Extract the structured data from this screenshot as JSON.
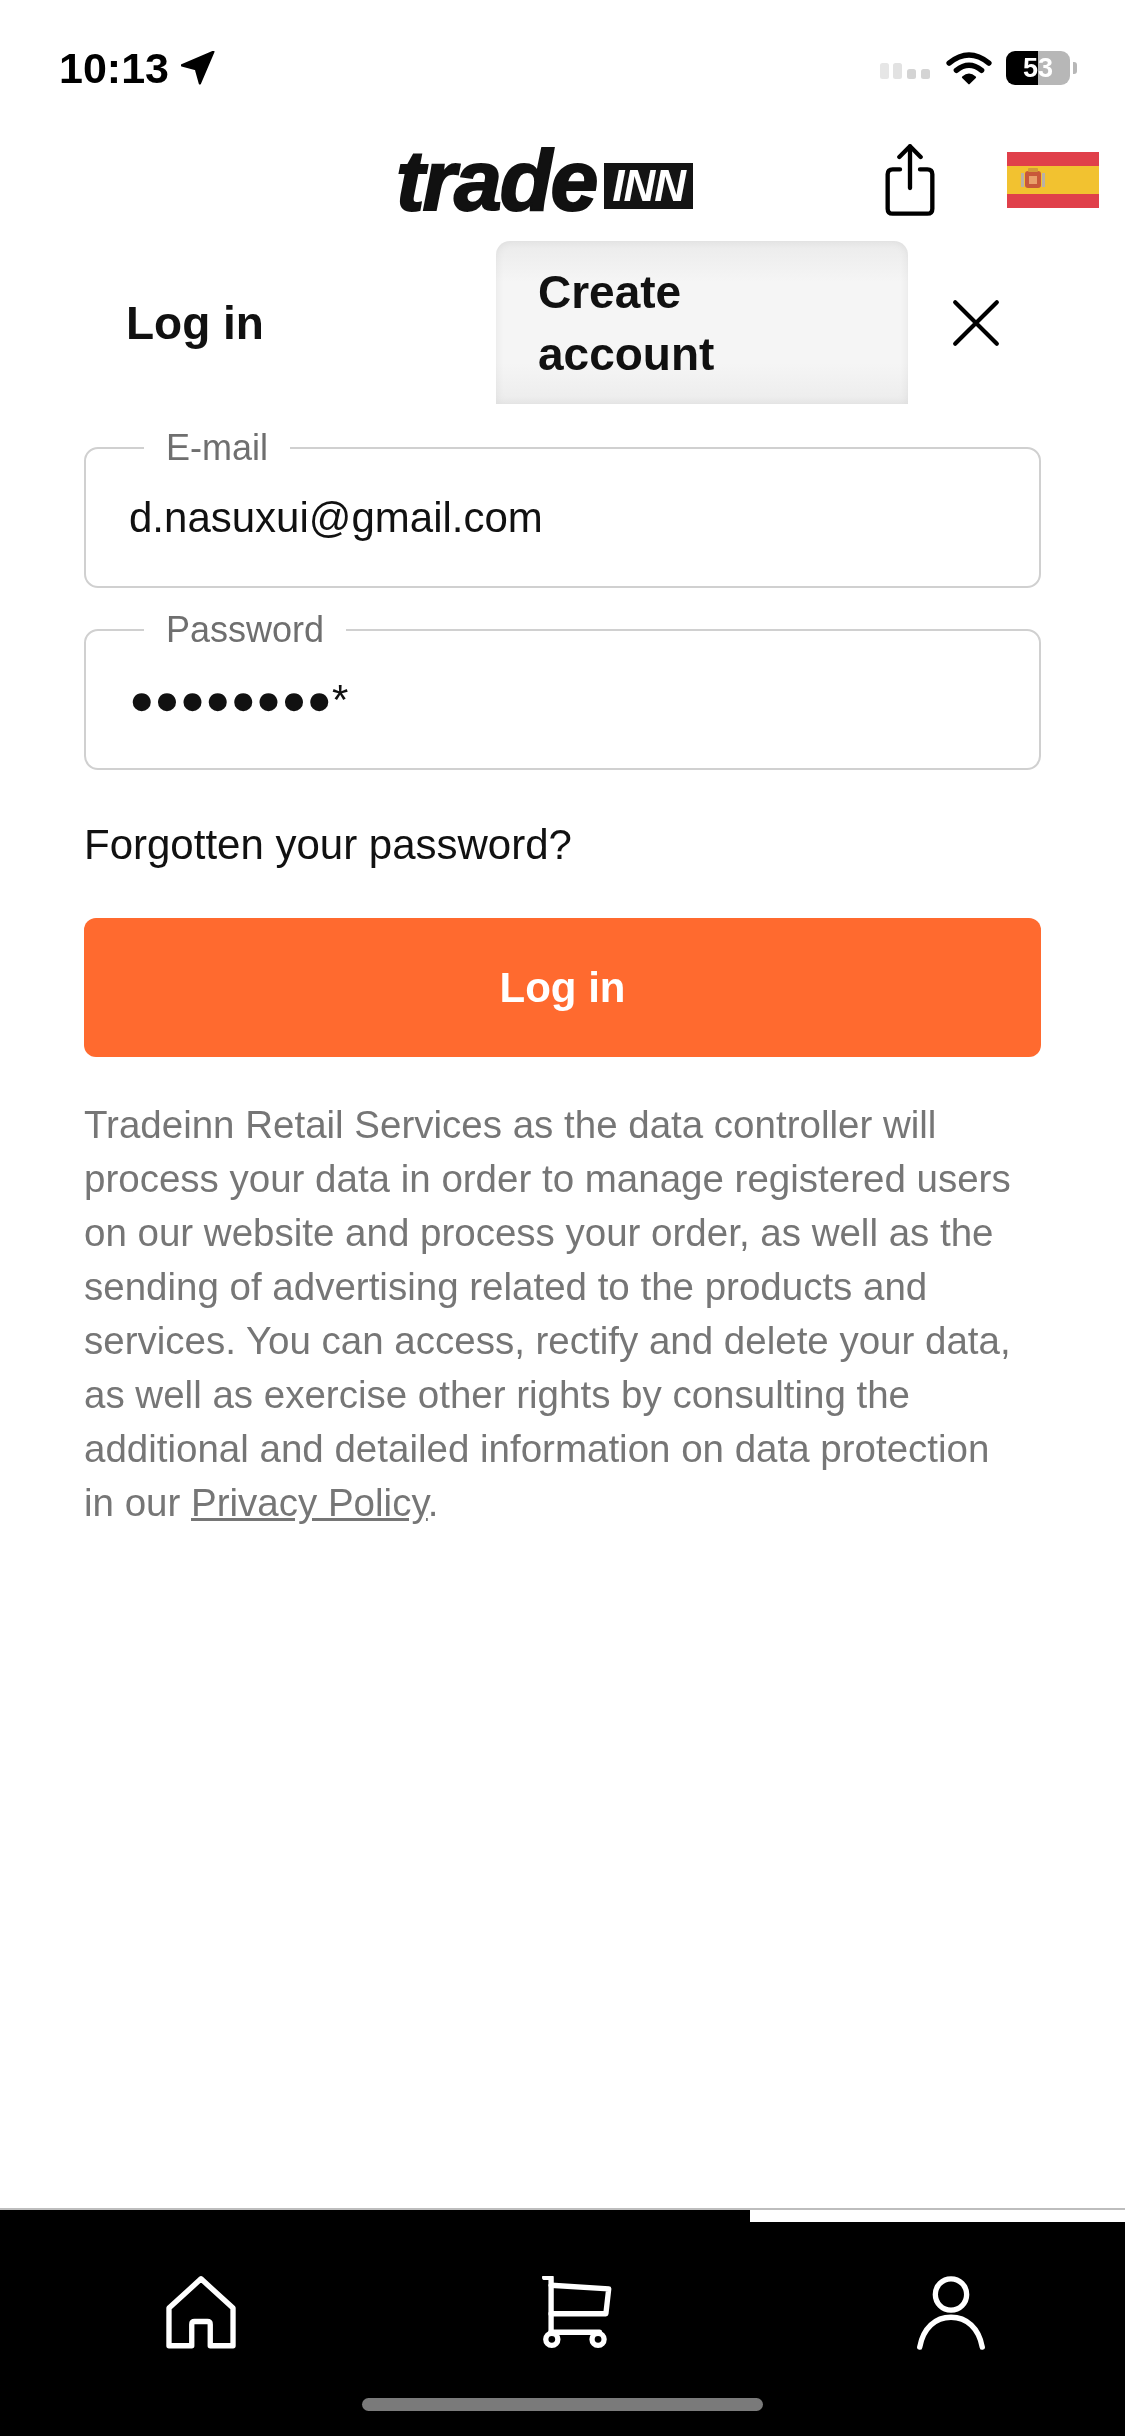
{
  "status_bar": {
    "time": "10:13",
    "battery": "53"
  },
  "header": {
    "logo": {
      "wordmark": "trade",
      "badge": "INN"
    }
  },
  "tabs": [
    {
      "label": "Log in",
      "selected": true
    },
    {
      "label": "Create account",
      "selected": false
    }
  ],
  "form": {
    "fields": [
      {
        "label": "E-mail",
        "value": "d.nasuxui@gmail.com"
      },
      {
        "label": "Password",
        "value": "●●●●●●●●*"
      }
    ],
    "forgot_link": "Forgotten your password?",
    "submit": "Log in"
  },
  "privacy_notice": {
    "text": "Tradeinn Retail Services as the data controller will process your data in order to manage registered users on our website and process your order, as well as the sending of advertising related to the products and services. You can access, rectify and delete your data, as well as exercise other rights by consulting the additional and detailed information on data protection in our ",
    "link": "Privacy Policy",
    "end": "."
  },
  "bottom_nav": {
    "items": [
      {
        "kind": "home",
        "selected": false
      },
      {
        "kind": "cart",
        "selected": false
      },
      {
        "kind": "profile",
        "selected": true
      }
    ]
  }
}
